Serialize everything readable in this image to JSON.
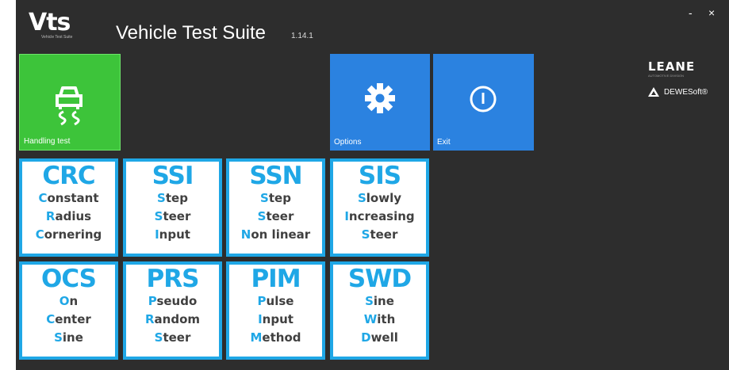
{
  "app": {
    "logo_text": "Vts",
    "logo_subtext": "Vehicle Test Suite",
    "title": "Vehicle Test Suite",
    "version": "1.14.1"
  },
  "window": {
    "minimize_label": "-",
    "close_label": "×"
  },
  "tiles": {
    "handling": {
      "label": "Handling test",
      "icon": "car-handling-icon",
      "color": "#3dc43a"
    },
    "options": {
      "label": "Options",
      "icon": "gear-icon",
      "color": "#2b82e0"
    },
    "exit": {
      "label": "Exit",
      "icon": "power-icon",
      "color": "#2b82e0"
    }
  },
  "brands": {
    "leane": "LEANE",
    "leane_sub": "AUTOMOTIVE DIVISION",
    "dewesoft": "DEWESoft®"
  },
  "accent_color": "#1fa7e6",
  "tests": [
    {
      "code": "CRC",
      "lines": [
        {
          "initial": "C",
          "rest": "onstant"
        },
        {
          "initial": "R",
          "rest": "adius"
        },
        {
          "initial": "C",
          "rest": "ornering"
        }
      ]
    },
    {
      "code": "SSI",
      "lines": [
        {
          "initial": "S",
          "rest": "tep"
        },
        {
          "initial": "S",
          "rest": "teer"
        },
        {
          "initial": "I",
          "rest": "nput"
        }
      ]
    },
    {
      "code": "SSN",
      "lines": [
        {
          "initial": "S",
          "rest": "tep"
        },
        {
          "initial": "S",
          "rest": "teer"
        },
        {
          "initial": "N",
          "rest": "on linear"
        }
      ]
    },
    {
      "code": "SIS",
      "lines": [
        {
          "initial": "S",
          "rest": "lowly"
        },
        {
          "initial": "I",
          "rest": "ncreasing"
        },
        {
          "initial": "S",
          "rest": "teer"
        }
      ]
    },
    {
      "code": "OCS",
      "lines": [
        {
          "initial": "O",
          "rest": "n"
        },
        {
          "initial": "C",
          "rest": "enter"
        },
        {
          "initial": "S",
          "rest": "ine"
        }
      ]
    },
    {
      "code": "PRS",
      "lines": [
        {
          "initial": "P",
          "rest": "seudo"
        },
        {
          "initial": "R",
          "rest": "andom"
        },
        {
          "initial": "S",
          "rest": "teer"
        }
      ]
    },
    {
      "code": "PIM",
      "lines": [
        {
          "initial": "P",
          "rest": "ulse"
        },
        {
          "initial": "I",
          "rest": "nput"
        },
        {
          "initial": "M",
          "rest": "ethod"
        }
      ]
    },
    {
      "code": "SWD",
      "lines": [
        {
          "initial": "S",
          "rest": "ine"
        },
        {
          "initial": "W",
          "rest": "ith"
        },
        {
          "initial": "D",
          "rest": "well"
        }
      ]
    }
  ]
}
